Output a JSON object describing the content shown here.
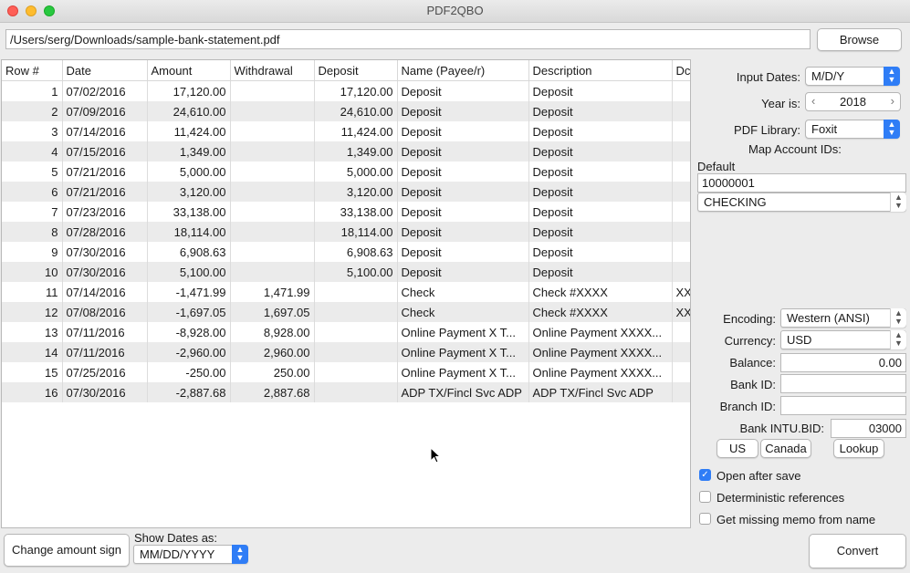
{
  "window": {
    "title": "PDF2QBO"
  },
  "file": {
    "path": "/Users/serg/Downloads/sample-bank-statement.pdf",
    "browse_label": "Browse"
  },
  "table": {
    "columns": [
      "Row #",
      "Date",
      "Amount",
      "Withdrawal",
      "Deposit",
      "Name (Payee/r)",
      "Description",
      "Dc"
    ],
    "rows": [
      [
        "1",
        "07/02/2016",
        "17,120.00",
        "",
        "17,120.00",
        "Deposit",
        "Deposit",
        ""
      ],
      [
        "2",
        "07/09/2016",
        "24,610.00",
        "",
        "24,610.00",
        "Deposit",
        "Deposit",
        ""
      ],
      [
        "3",
        "07/14/2016",
        "11,424.00",
        "",
        "11,424.00",
        "Deposit",
        "Deposit",
        ""
      ],
      [
        "4",
        "07/15/2016",
        "1,349.00",
        "",
        "1,349.00",
        "Deposit",
        "Deposit",
        ""
      ],
      [
        "5",
        "07/21/2016",
        "5,000.00",
        "",
        "5,000.00",
        "Deposit",
        "Deposit",
        ""
      ],
      [
        "6",
        "07/21/2016",
        "3,120.00",
        "",
        "3,120.00",
        "Deposit",
        "Deposit",
        ""
      ],
      [
        "7",
        "07/23/2016",
        "33,138.00",
        "",
        "33,138.00",
        "Deposit",
        "Deposit",
        ""
      ],
      [
        "8",
        "07/28/2016",
        "18,114.00",
        "",
        "18,114.00",
        "Deposit",
        "Deposit",
        ""
      ],
      [
        "9",
        "07/30/2016",
        "6,908.63",
        "",
        "6,908.63",
        "Deposit",
        "Deposit",
        ""
      ],
      [
        "10",
        "07/30/2016",
        "5,100.00",
        "",
        "5,100.00",
        "Deposit",
        "Deposit",
        ""
      ],
      [
        "11",
        "07/14/2016",
        "-1,471.99",
        "1,471.99",
        "",
        "Check",
        "Check #XXXX",
        "XX"
      ],
      [
        "12",
        "07/08/2016",
        "-1,697.05",
        "1,697.05",
        "",
        "Check",
        "Check #XXXX",
        "XX"
      ],
      [
        "13",
        "07/11/2016",
        "-8,928.00",
        "8,928.00",
        "",
        "Online Payment X T...",
        "Online Payment XXXX...",
        ""
      ],
      [
        "14",
        "07/11/2016",
        "-2,960.00",
        "2,960.00",
        "",
        "Online Payment X T...",
        "Online Payment XXXX...",
        ""
      ],
      [
        "15",
        "07/25/2016",
        "-250.00",
        "250.00",
        "",
        "Online Payment X T...",
        "Online Payment XXXX...",
        ""
      ],
      [
        "16",
        "07/30/2016",
        "-2,887.68",
        "2,887.68",
        "",
        "ADP TX/Fincl Svc ADP",
        "ADP TX/Fincl Svc ADP",
        ""
      ]
    ]
  },
  "settings": {
    "input_dates_label": "Input Dates:",
    "input_dates_value": "M/D/Y",
    "year_label": "Year is:",
    "year_value": "2018",
    "pdf_library_label": "PDF Library:",
    "pdf_library_value": "Foxit",
    "map_account_label": "Map Account IDs:",
    "default_label": "Default",
    "account_id": "10000001",
    "account_type": "CHECKING",
    "encoding_label": "Encoding:",
    "encoding_value": "Western (ANSI)",
    "currency_label": "Currency:",
    "currency_value": "USD",
    "balance_label": "Balance:",
    "balance_value": "0.00",
    "bank_id_label": "Bank ID:",
    "bank_id_value": "",
    "branch_id_label": "Branch ID:",
    "branch_id_value": "",
    "intu_label": "Bank INTU.BID:",
    "intu_value": "03000",
    "us_label": "US",
    "canada_label": "Canada",
    "lookup_label": "Lookup",
    "open_after_save_label": "Open after save",
    "open_after_save_checked": true,
    "deterministic_label": "Deterministic references",
    "deterministic_checked": false,
    "missing_memo_label": "Get missing memo from name",
    "missing_memo_checked": false
  },
  "bottom": {
    "change_sign_label": "Change amount sign",
    "show_dates_label": "Show Dates as:",
    "show_dates_value": "MM/DD/YYYY",
    "convert_label": "Convert"
  },
  "colors": {
    "accent": "#2f7df6",
    "row_alt": "#ebebeb"
  }
}
